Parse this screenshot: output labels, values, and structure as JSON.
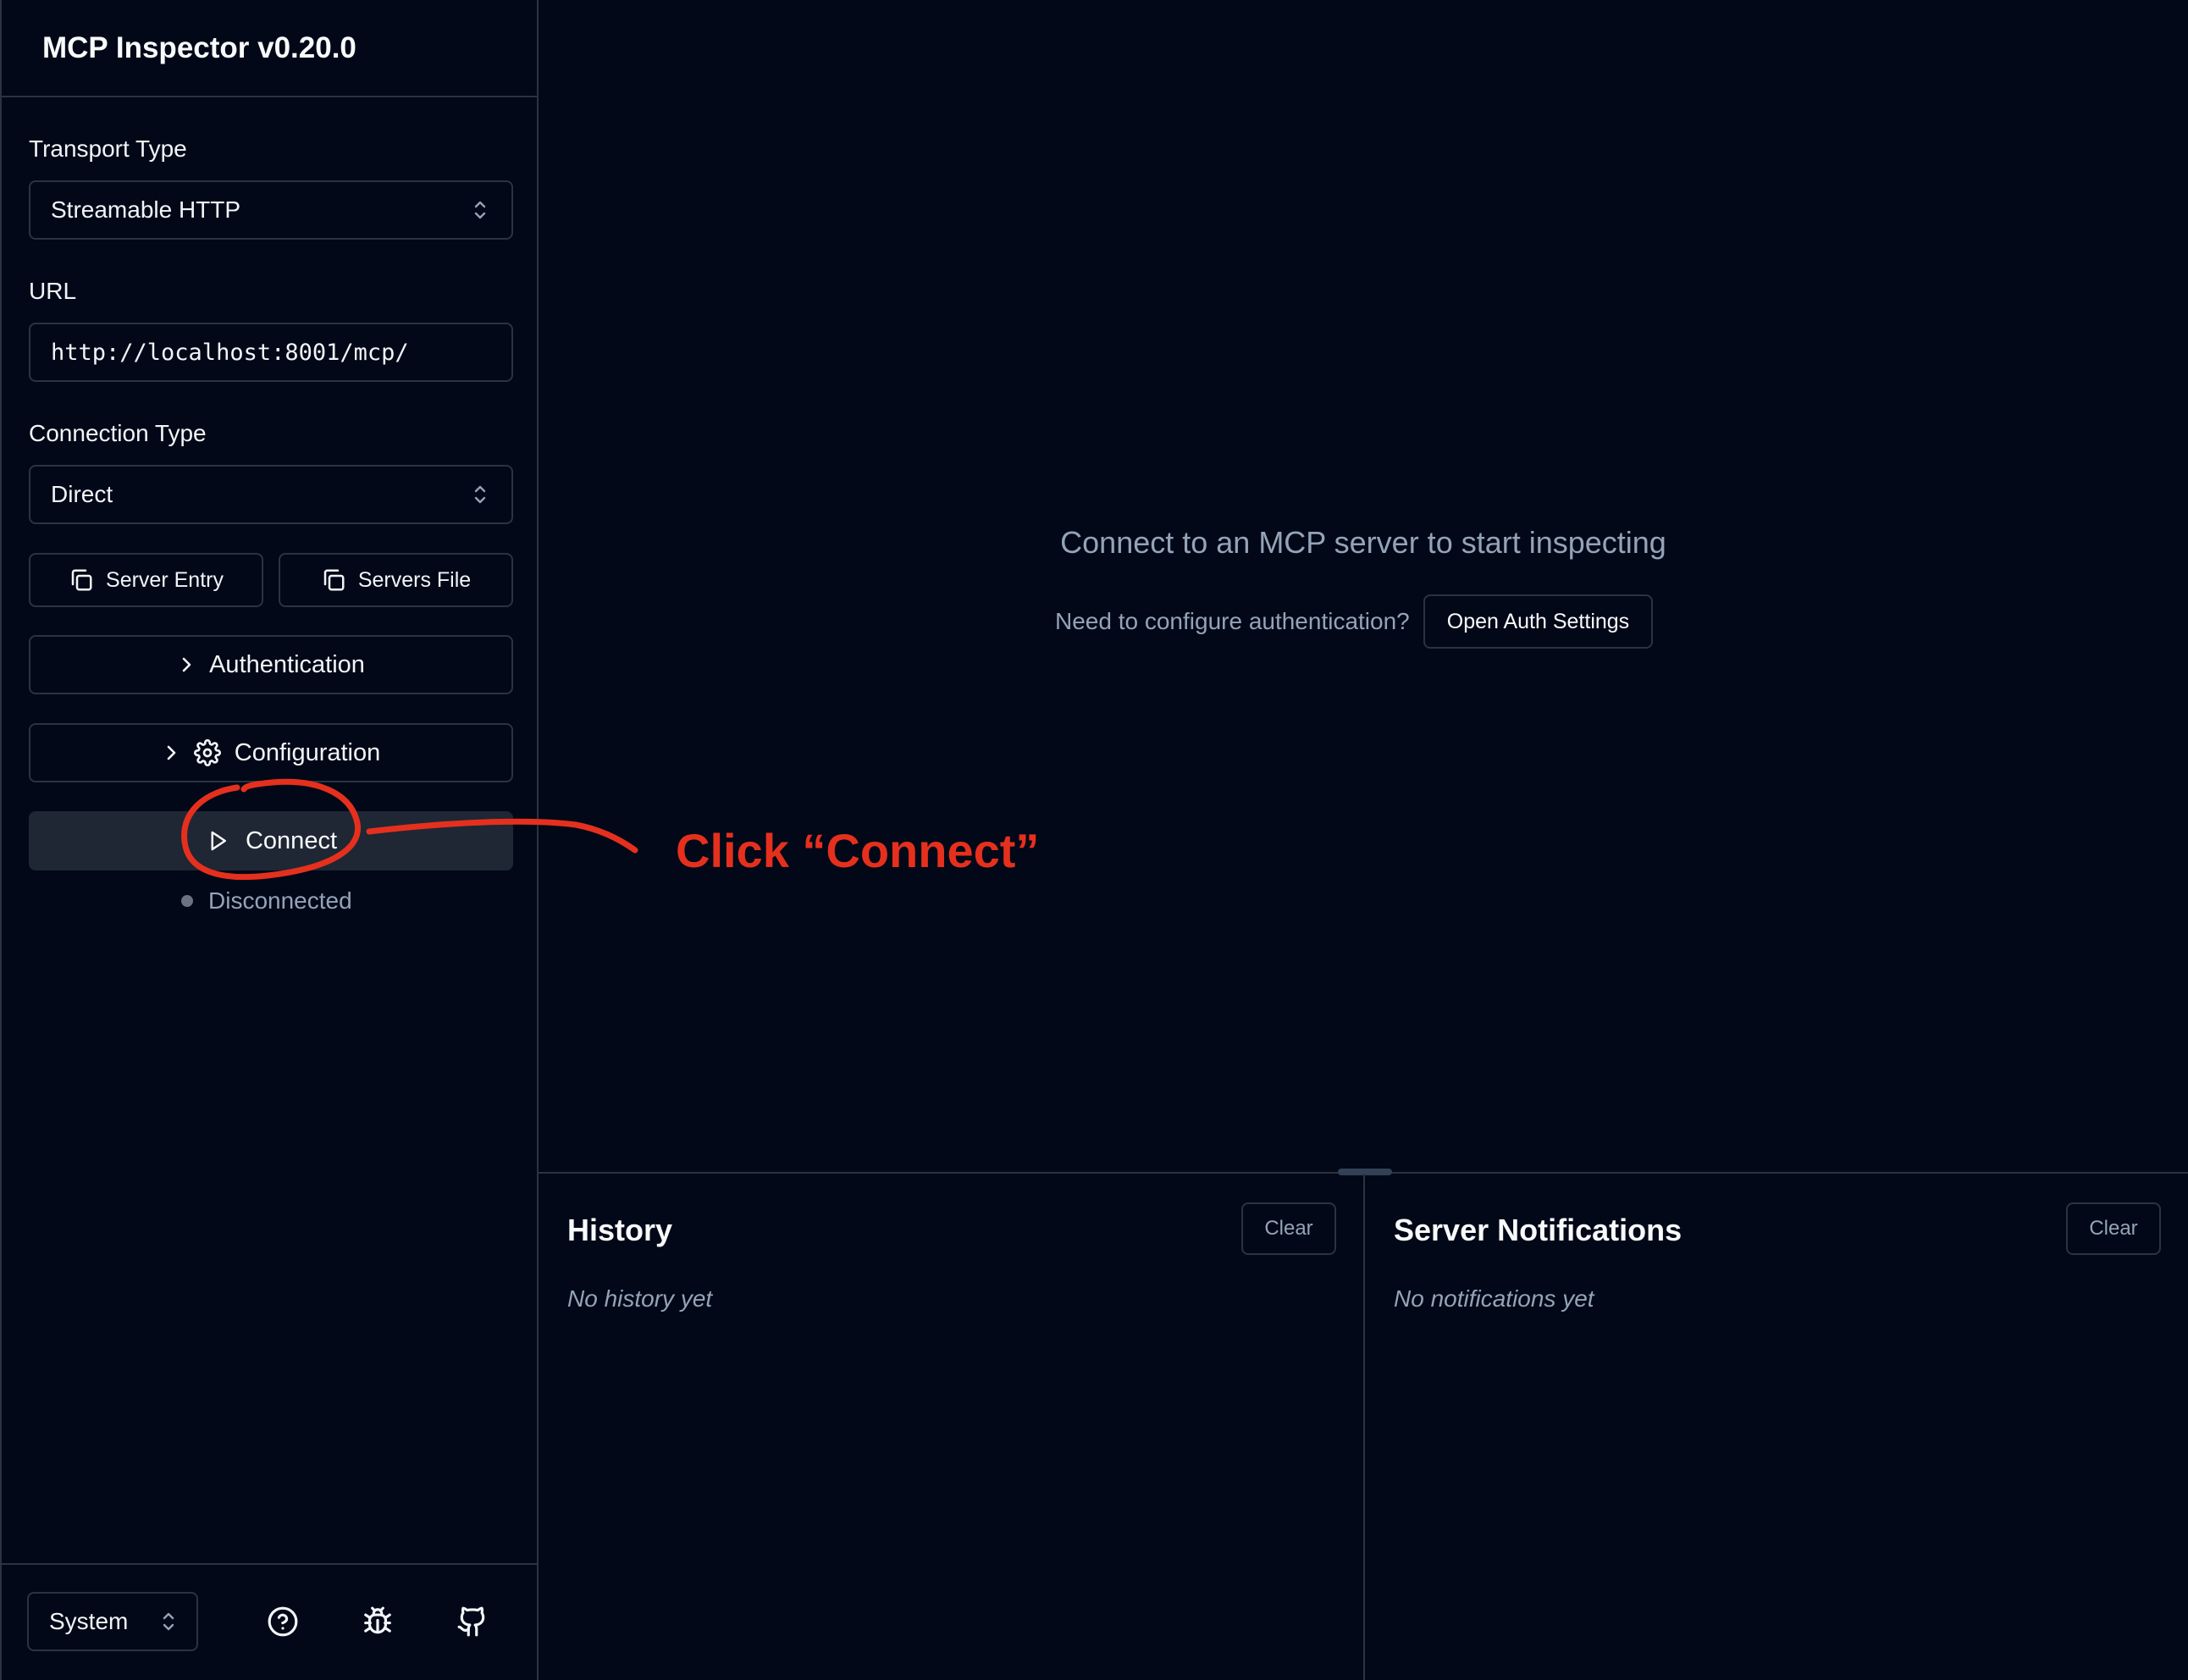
{
  "app": {
    "title": "MCP Inspector v0.20.0"
  },
  "sidebar": {
    "transport": {
      "label": "Transport Type",
      "value": "Streamable HTTP"
    },
    "url": {
      "label": "URL",
      "value": "http://localhost:8001/mcp/"
    },
    "connection": {
      "label": "Connection Type",
      "value": "Direct"
    },
    "server_entry_label": "Server Entry",
    "servers_file_label": "Servers File",
    "authentication_label": "Authentication",
    "configuration_label": "Configuration",
    "connect_label": "Connect",
    "status_text": "Disconnected",
    "theme_value": "System"
  },
  "main": {
    "empty_title": "Connect to an MCP server to start inspecting",
    "auth_prompt": "Need to configure authentication?",
    "open_auth_label": "Open Auth Settings"
  },
  "history": {
    "title": "History",
    "clear_label": "Clear",
    "empty": "No history yet"
  },
  "notifications": {
    "title": "Server Notifications",
    "clear_label": "Clear",
    "empty": "No notifications yet"
  },
  "annotation": {
    "text": "Click “Connect”",
    "color": "#e5301e"
  },
  "colors": {
    "background": "#020817",
    "border": "#2a3341",
    "connect_button": "#1e2733",
    "muted_text": "#94a3b8"
  }
}
